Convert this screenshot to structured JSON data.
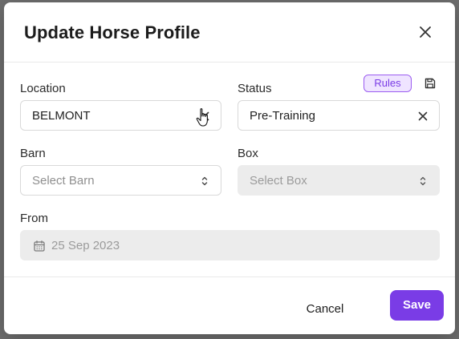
{
  "modal": {
    "title": "Update Horse Profile"
  },
  "location": {
    "label": "Location",
    "value": "BELMONT"
  },
  "status": {
    "label": "Status",
    "value": "Pre-Training",
    "rules_label": "Rules"
  },
  "barn": {
    "label": "Barn",
    "placeholder": "Select Barn"
  },
  "box": {
    "label": "Box",
    "placeholder": "Select Box"
  },
  "from": {
    "label": "From",
    "value": "25 Sep 2023"
  },
  "footer": {
    "cancel_label": "Cancel",
    "save_label": "Save"
  },
  "colors": {
    "accent": "#7a3ce6",
    "accent_light": "#efe4ff",
    "disabled_bg": "#ececec"
  }
}
